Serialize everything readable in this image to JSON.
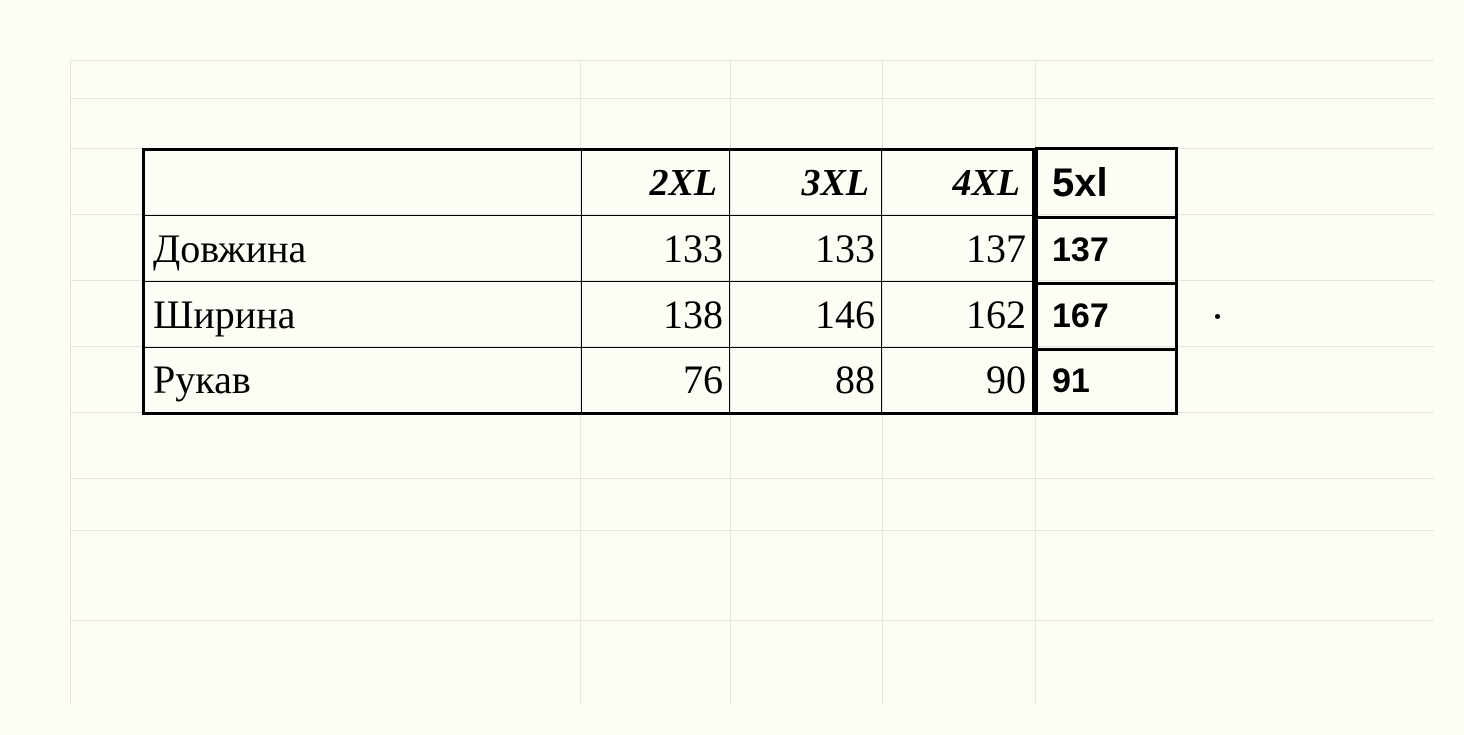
{
  "chart_data": {
    "type": "table",
    "title": "",
    "columns": [
      "2XL",
      "3XL",
      "4XL",
      "5xl"
    ],
    "rows": [
      "Довжина",
      "Ширина",
      "Рукав"
    ],
    "values": [
      [
        133,
        133,
        137,
        137
      ],
      [
        138,
        146,
        162,
        167
      ],
      [
        76,
        88,
        90,
        91
      ]
    ]
  },
  "table": {
    "blank_header": "",
    "size_headers": {
      "s1": "2XL",
      "s2": "3XL",
      "s3": "4XL"
    },
    "rows": {
      "r1": {
        "label": "Довжина",
        "s1": "133",
        "s2": "133",
        "s3": "137"
      },
      "r2": {
        "label": "Ширина",
        "s1": "138",
        "s2": "146",
        "s3": "162"
      },
      "r3": {
        "label": "Рукав",
        "s1": "76",
        "s2": "88",
        "s3": "90"
      }
    }
  },
  "extra_column": {
    "header": "5xl",
    "v1": "137",
    "v2": "167",
    "v3": "91"
  }
}
